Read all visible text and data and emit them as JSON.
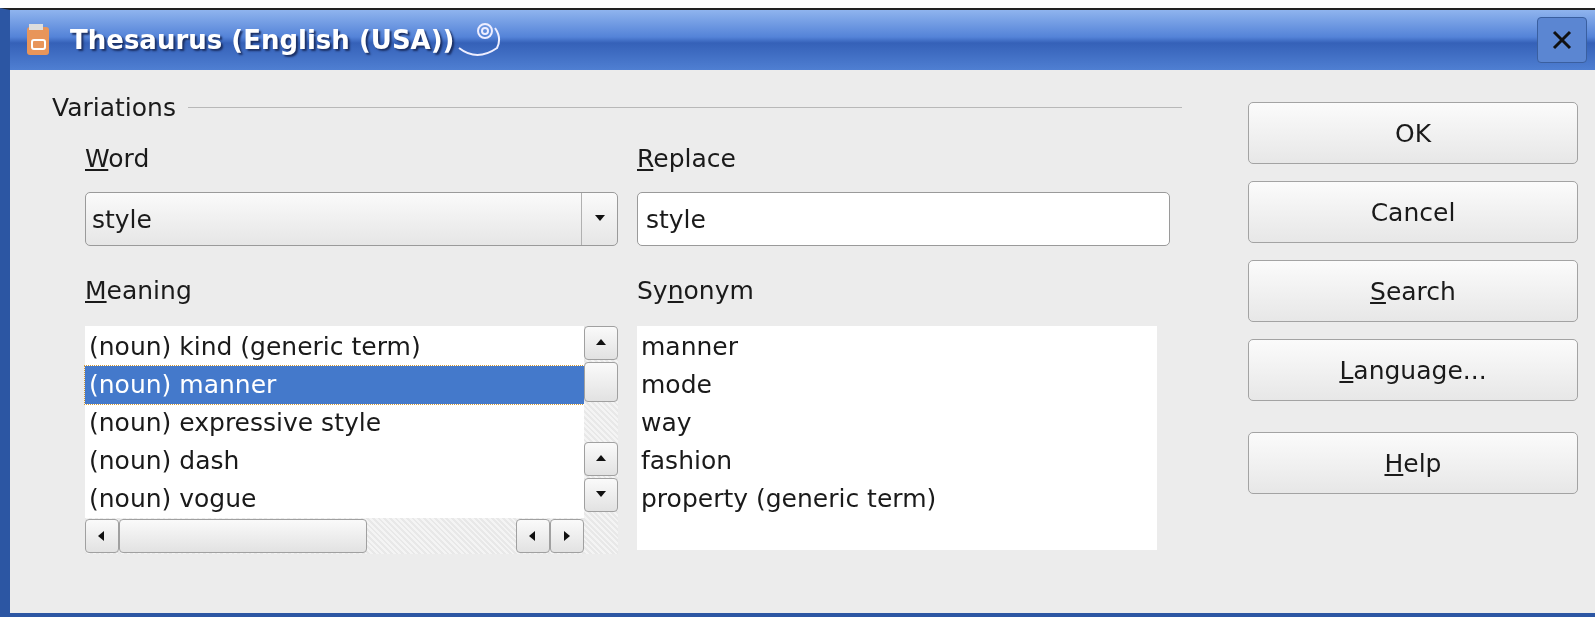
{
  "window": {
    "title": "Thesaurus (English (USA))"
  },
  "frame": {
    "title": "Variations"
  },
  "word": {
    "label": {
      "key": "W",
      "after": "ord"
    },
    "value": "style"
  },
  "replace": {
    "label": {
      "key": "R",
      "after": "eplace"
    },
    "value": "style"
  },
  "meaning": {
    "label": {
      "key": "M",
      "after": "eaning"
    },
    "items": [
      {
        "text": "(noun) kind (generic term)",
        "selected": false
      },
      {
        "text": "(noun) manner",
        "selected": true
      },
      {
        "text": "(noun) expressive style",
        "selected": false
      },
      {
        "text": "(noun) dash",
        "selected": false
      },
      {
        "text": "(noun) vogue",
        "selected": false
      }
    ]
  },
  "synonym": {
    "label": {
      "before": "Sy",
      "key": "n",
      "after": "onym"
    },
    "items": [
      "manner",
      "mode",
      "way",
      "fashion",
      "property (generic term)"
    ]
  },
  "buttons": [
    {
      "label": {
        "after": "OK"
      }
    },
    {
      "label": {
        "after": "Cancel"
      }
    },
    {
      "label": {
        "key": "S",
        "after": "earch"
      }
    },
    {
      "label": {
        "key": "L",
        "after": "anguage..."
      }
    },
    {
      "label": {
        "key": "H",
        "after": "elp"
      }
    }
  ]
}
